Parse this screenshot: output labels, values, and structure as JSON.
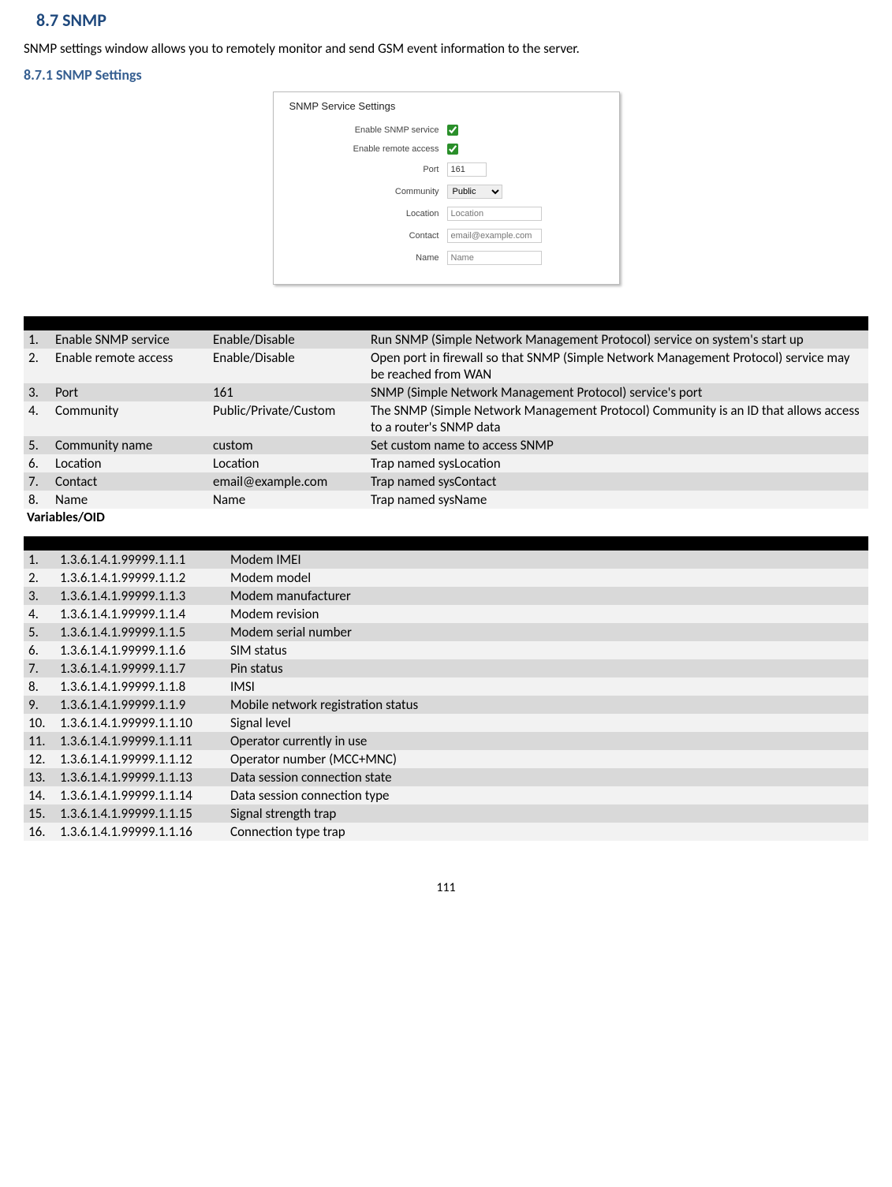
{
  "headings": {
    "h87": "8.7   SNMP",
    "h871": "8.7.1  SNMP Settings"
  },
  "intro": "SNMP settings window allows you to remotely monitor and send GSM event information to the server.",
  "panel": {
    "title": "SNMP Service Settings",
    "rows": {
      "enable_service_label": "Enable SNMP service",
      "enable_remote_label": "Enable remote access",
      "port_label": "Port",
      "port_value": "161",
      "community_label": "Community",
      "community_value": "Public",
      "location_label": "Location",
      "location_placeholder": "Location",
      "contact_label": "Contact",
      "contact_placeholder": "email@example.com",
      "name_label": "Name",
      "name_placeholder": "Name"
    }
  },
  "settings_rows": [
    {
      "n": "1.",
      "field": "Enable SNMP service",
      "val": "Enable/Disable",
      "desc": "Run SNMP (Simple Network Management Protocol) service on system's start up"
    },
    {
      "n": "2.",
      "field": "Enable remote access",
      "val": "Enable/Disable",
      "desc": "Open port in firewall so that SNMP (Simple Network Management Protocol) service may be reached from WAN"
    },
    {
      "n": "3.",
      "field": "Port",
      "val": "161",
      "desc": "SNMP (Simple Network Management Protocol) service's port"
    },
    {
      "n": "4.",
      "field": "Community",
      "val": "Public/Private/Custom",
      "desc": "The SNMP (Simple Network Management Protocol) Community is an ID that allows access to a router's SNMP data"
    },
    {
      "n": "5.",
      "field": "Community name",
      "val": "custom",
      "desc": "Set custom name to access SNMP"
    },
    {
      "n": "6.",
      "field": "Location",
      "val": "Location",
      "desc": "Trap named sysLocation"
    },
    {
      "n": "7.",
      "field": "Contact",
      "val": "email@example.com",
      "desc": "Trap named sysContact"
    },
    {
      "n": "8.",
      "field": "Name",
      "val": "Name",
      "desc": "Trap named sysName"
    }
  ],
  "varlabel": "Variables/OID",
  "oid_rows": [
    {
      "n": "1.",
      "oid": "1.3.6.1.4.1.99999.1.1.1",
      "desc": "Modem IMEI"
    },
    {
      "n": "2.",
      "oid": "1.3.6.1.4.1.99999.1.1.2",
      "desc": "Modem model"
    },
    {
      "n": "3.",
      "oid": "1.3.6.1.4.1.99999.1.1.3",
      "desc": "Modem manufacturer"
    },
    {
      "n": "4.",
      "oid": "1.3.6.1.4.1.99999.1.1.4",
      "desc": "Modem revision"
    },
    {
      "n": "5.",
      "oid": "1.3.6.1.4.1.99999.1.1.5",
      "desc": "Modem serial number"
    },
    {
      "n": "6.",
      "oid": "1.3.6.1.4.1.99999.1.1.6",
      "desc": "SIM status"
    },
    {
      "n": "7.",
      "oid": "1.3.6.1.4.1.99999.1.1.7",
      "desc": "Pin status"
    },
    {
      "n": "8.",
      "oid": "1.3.6.1.4.1.99999.1.1.8",
      "desc": "IMSI"
    },
    {
      "n": "9.",
      "oid": "1.3.6.1.4.1.99999.1.1.9",
      "desc": "Mobile network registration status"
    },
    {
      "n": "10.",
      "oid": "1.3.6.1.4.1.99999.1.1.10",
      "desc": "Signal level"
    },
    {
      "n": "11.",
      "oid": "1.3.6.1.4.1.99999.1.1.11",
      "desc": "Operator currently in use"
    },
    {
      "n": "12.",
      "oid": "1.3.6.1.4.1.99999.1.1.12",
      "desc": "Operator number (MCC+MNC)"
    },
    {
      "n": "13.",
      "oid": "1.3.6.1.4.1.99999.1.1.13",
      "desc": "Data session connection state"
    },
    {
      "n": "14.",
      "oid": "1.3.6.1.4.1.99999.1.1.14",
      "desc": "Data session connection type"
    },
    {
      "n": "15.",
      "oid": "1.3.6.1.4.1.99999.1.1.15",
      "desc": "Signal strength trap"
    },
    {
      "n": "16.",
      "oid": "1.3.6.1.4.1.99999.1.1.16",
      "desc": "Connection type trap"
    }
  ],
  "pagenum": "111"
}
